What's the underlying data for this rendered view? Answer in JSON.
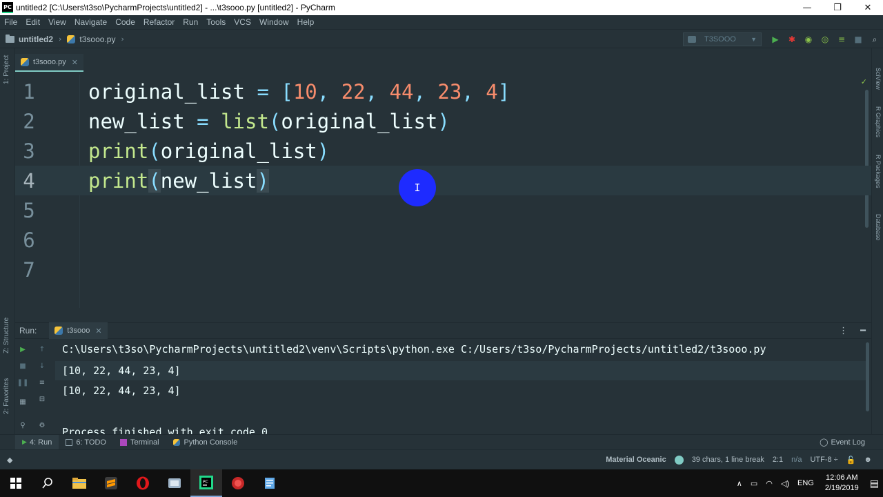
{
  "window": {
    "title": "untitled2 [C:\\Users\\t3so\\PycharmProjects\\untitled2] - ...\\t3sooo.py [untitled2] - PyCharm",
    "app_icon_text": "PC",
    "min": "—",
    "restore": "❐",
    "close": "✕"
  },
  "menu": [
    "File",
    "Edit",
    "View",
    "Navigate",
    "Code",
    "Refactor",
    "Run",
    "Tools",
    "VCS",
    "Window",
    "Help"
  ],
  "breadcrumb": {
    "project": "untitled2",
    "file": "t3sooo.py"
  },
  "toolbar": {
    "run_config": "T3SOOO"
  },
  "left_tools": [
    "1: Project",
    "Z: Structure",
    "2: Favorites"
  ],
  "right_tools": [
    "SciView",
    "R Graphics",
    "R Packages",
    "Database"
  ],
  "editor": {
    "tab": "t3sooo.py",
    "line_numbers": [
      "1",
      "2",
      "3",
      "4",
      "5",
      "6",
      "7"
    ],
    "lines": {
      "l1": {
        "ident": "original_list",
        "op": " = ",
        "lb": "[",
        "n1": "10",
        "n2": "22",
        "n3": "44",
        "n4": "23",
        "n5": "4",
        "comma": ", ",
        "rb": "]"
      },
      "l2": {
        "ident": "new_list",
        "op": " = ",
        "fn": "list",
        "lp": "(",
        "arg": "original_list",
        "rp": ")"
      },
      "l3": {
        "fn": "print",
        "lp": "(",
        "arg": "original_list",
        "rp": ")"
      },
      "l4": {
        "fn": "print",
        "lp": "(",
        "arg": "new_list",
        "rp": ")"
      }
    }
  },
  "run_panel": {
    "label": "Run:",
    "tab": "t3sooo",
    "output": [
      "C:\\Users\\t3so\\PycharmProjects\\untitled2\\venv\\Scripts\\python.exe C:/Users/t3so/PycharmProjects/untitled2/t3sooo.py",
      "[10, 22, 44, 23, 4]",
      "[10, 22, 44, 23, 4]",
      "",
      "Process finished with exit code 0"
    ]
  },
  "bottom_tabs": {
    "run": "4: Run",
    "todo": "6: TODO",
    "terminal": "Terminal",
    "python_console": "Python Console",
    "event_log": "Event Log"
  },
  "status": {
    "theme": "Material Oceanic",
    "chars": "39 chars, 1 line break",
    "position": "2:1",
    "na": "n/a",
    "encoding": "UTF-8 ÷"
  },
  "taskbar": {
    "lang": "ENG",
    "time": "12:06 AM",
    "date": "2/19/2019"
  },
  "colors": {
    "background": "#263238",
    "accent": "#80cbc4",
    "keyword_builtin": "#c3e88d",
    "number": "#f78c6c",
    "punctuation": "#89ddff",
    "cursor_highlight": "#1e2bff"
  }
}
